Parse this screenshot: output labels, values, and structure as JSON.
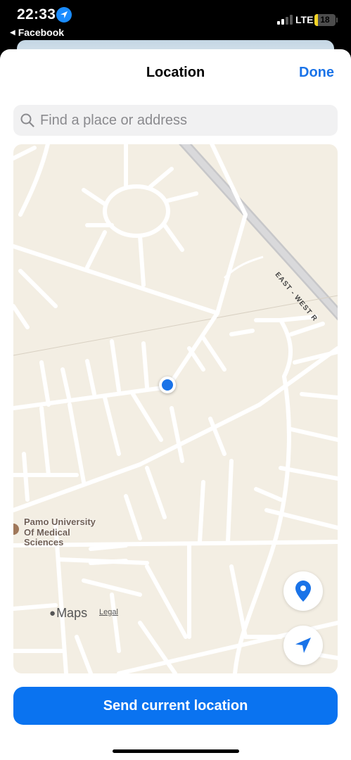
{
  "status_bar": {
    "time": "22:33",
    "back_app": "Facebook",
    "network": "LTE",
    "battery": "18",
    "battery_level_percent": 18,
    "location_icon": "location-arrow-icon"
  },
  "sheet": {
    "title": "Location",
    "done_label": "Done"
  },
  "search": {
    "placeholder": "Find a place or address",
    "value": "",
    "icon": "search-icon"
  },
  "map": {
    "poi_name": "Pamo University Of Medical Sciences",
    "poi_lines": [
      "Pamo University",
      "Of Medical",
      "Sciences"
    ],
    "road_label": "EAST - WEST R",
    "maps_brand": "Maps",
    "legal": "Legal",
    "pin_button_icon": "map-pin-icon",
    "locate_button_icon": "location-arrow-icon",
    "user_dot_color": "#1a73e8"
  },
  "footer": {
    "send_label": "Send current location"
  },
  "colors": {
    "accent": "#1a73e8",
    "button": "#0a73f0",
    "map_background": "#f3eee3"
  }
}
